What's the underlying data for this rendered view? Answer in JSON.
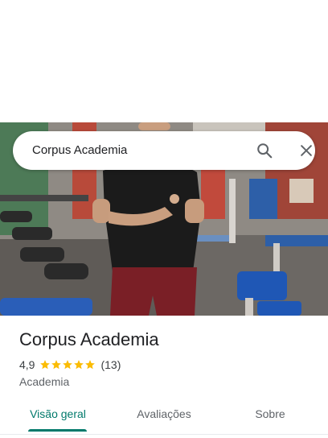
{
  "search": {
    "query": "Corpus Academia"
  },
  "place": {
    "name": "Corpus Academia",
    "rating": "4,9",
    "stars": 5,
    "reviews": "(13)",
    "category": "Academia"
  },
  "tabs": [
    {
      "label": "Visão geral",
      "active": true
    },
    {
      "label": "Avaliações",
      "active": false
    },
    {
      "label": "Sobre",
      "active": false
    }
  ],
  "colors": {
    "accent": "#00796b",
    "star": "#fbbc04"
  },
  "icons": [
    "search-icon",
    "close-icon",
    "star-icon"
  ]
}
